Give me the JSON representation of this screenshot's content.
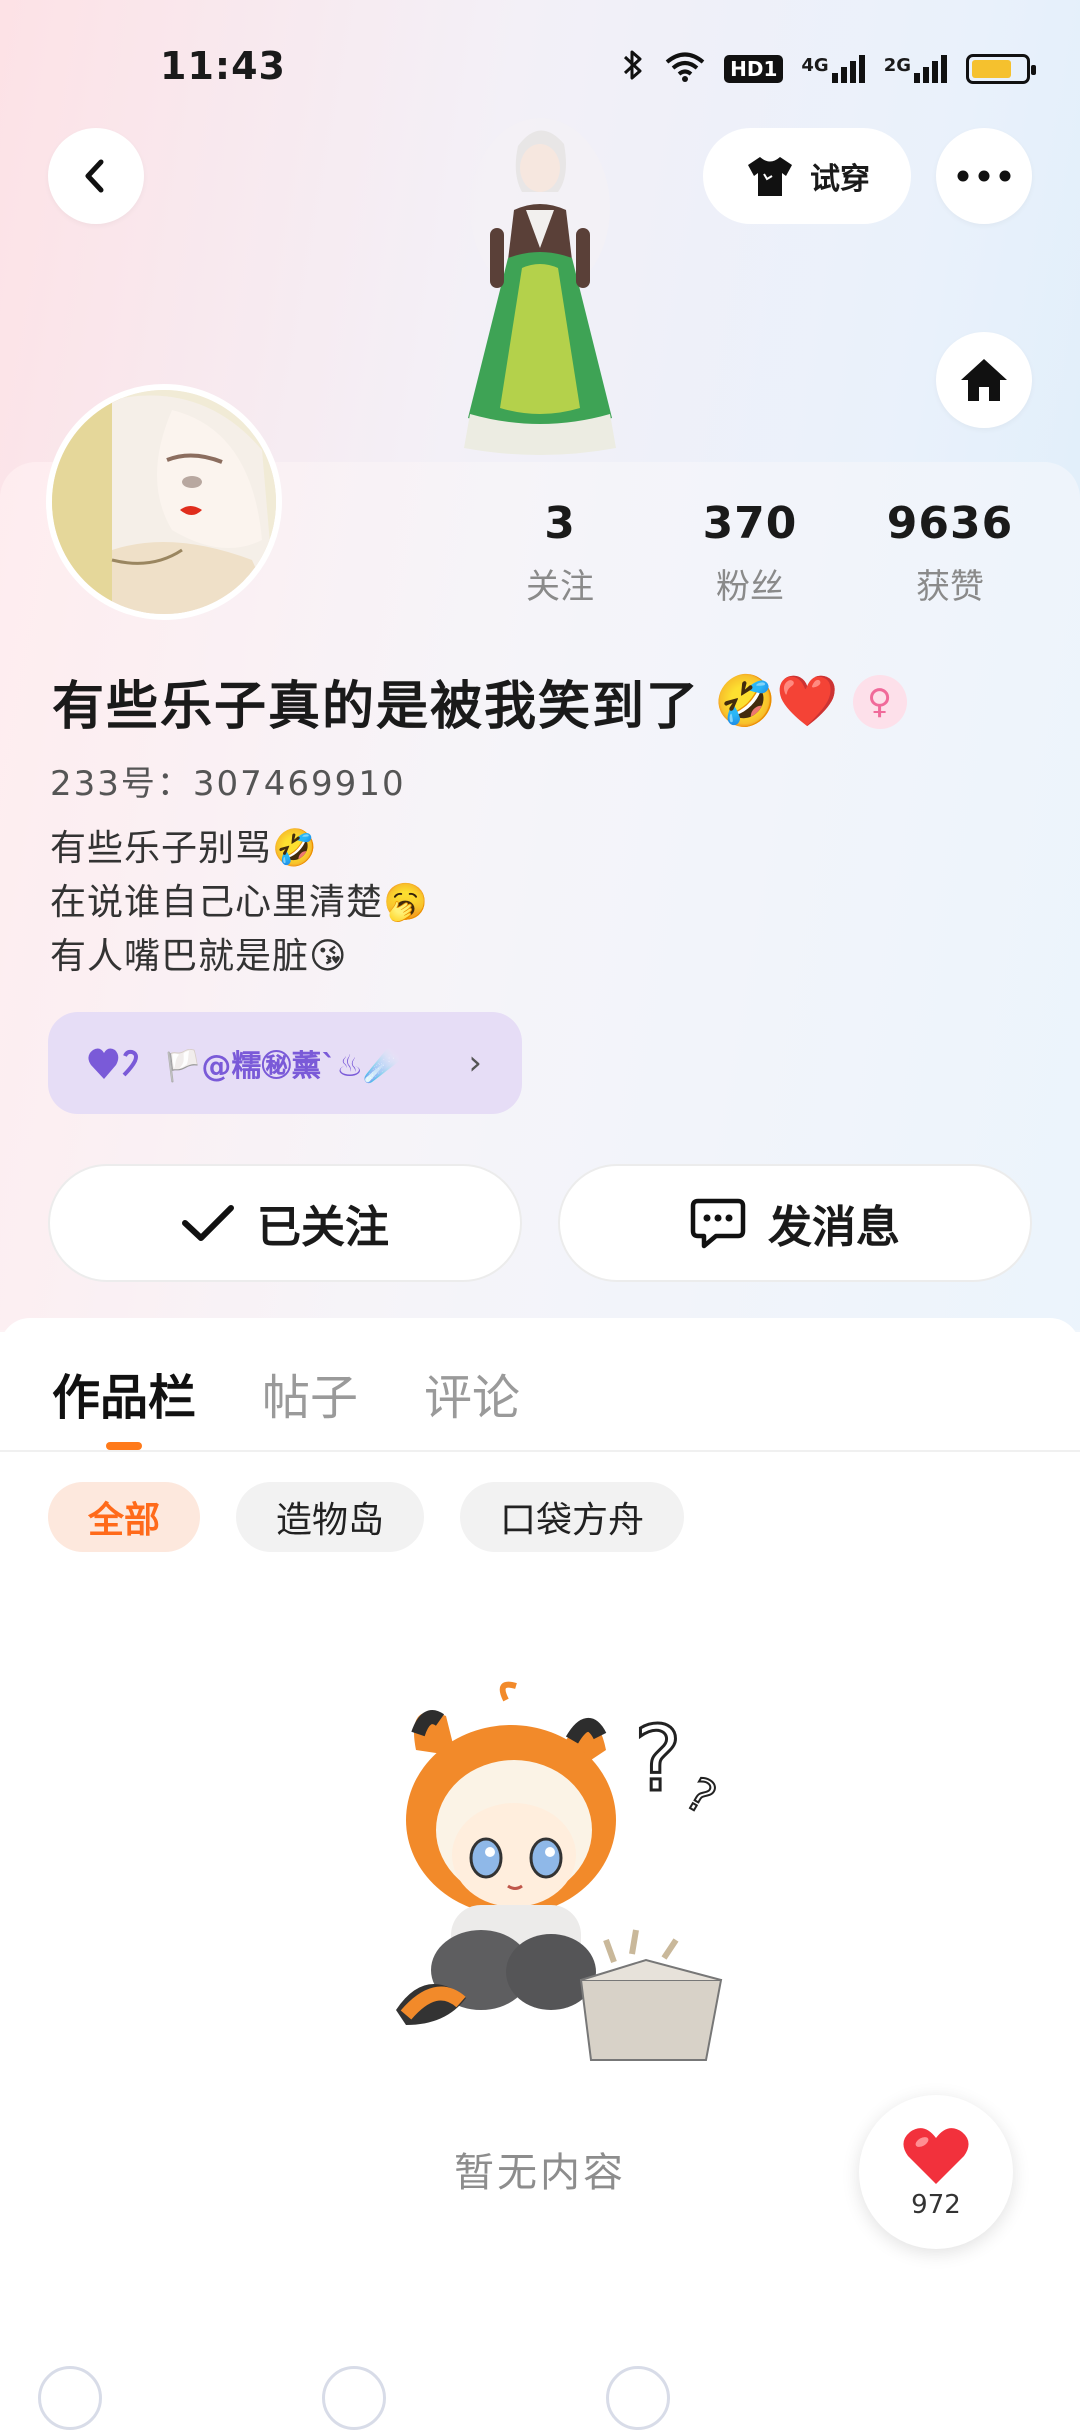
{
  "status_bar": {
    "time": "11:43",
    "network_hd": "HD1",
    "network_4g": "4G",
    "network_2g": "2G",
    "battery_level": 0.75
  },
  "header": {
    "try_on_label": "试穿"
  },
  "stats": [
    {
      "value": "3",
      "label": "关注"
    },
    {
      "value": "370",
      "label": "粉丝"
    },
    {
      "value": "9636",
      "label": "获赞"
    }
  ],
  "profile": {
    "name": "有些乐子真的是被我笑到了",
    "name_emojis": "🤣❤️",
    "gender_symbol": "♀",
    "uid": "233号：307469910",
    "bio": [
      "有些乐子别骂🤣",
      "在说谁自己心里清楚🥱",
      "有人嘴巴就是脏😘"
    ],
    "relation_text": "🏳️@糯㊙薰`♨☄️"
  },
  "actions": {
    "follow_label": "已关注",
    "message_label": "发消息"
  },
  "tabs": [
    "作品栏",
    "帖子",
    "评论"
  ],
  "chips": [
    "全部",
    "造物岛",
    "口袋方舟"
  ],
  "empty_text": "暂无内容",
  "like_count": "972",
  "colors": {
    "accent": "#ff7a1a",
    "relation_bg": "#e6ddf6",
    "like_red": "#f2313c"
  }
}
